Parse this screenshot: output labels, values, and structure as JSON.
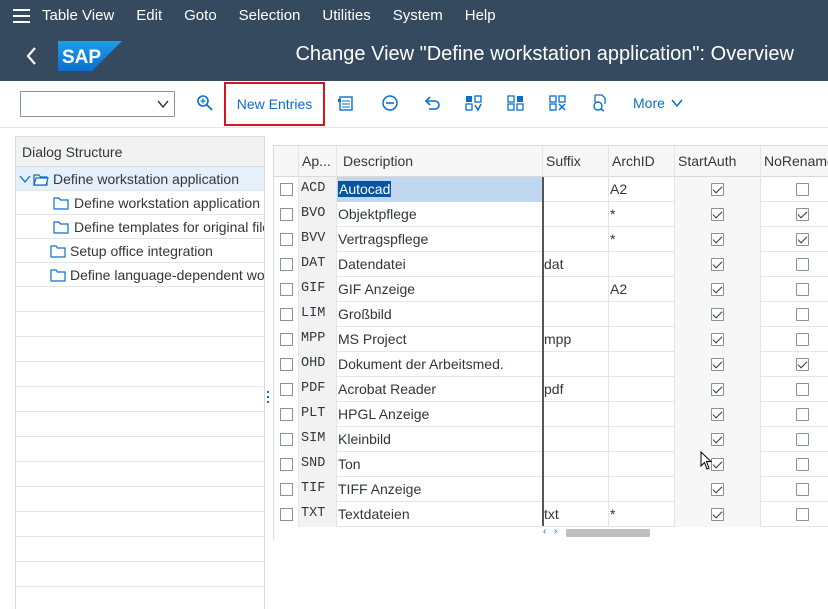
{
  "menu": [
    "Table View",
    "Edit",
    "Goto",
    "Selection",
    "Utilities",
    "System",
    "Help"
  ],
  "title": "Change View \"Define workstation application\": Overview",
  "logo_text": "SAP",
  "toolbar": {
    "new_entries": "New Entries",
    "more": "More"
  },
  "tree": {
    "header": "Dialog Structure",
    "items": [
      {
        "label": "Define workstation application",
        "level": 0
      },
      {
        "label": "Define workstation application in",
        "level": 1
      },
      {
        "label": "Define templates for original files",
        "level": 1
      },
      {
        "label": "Setup office integration",
        "level": 0
      },
      {
        "label": "Define language-dependent wor",
        "level": 0
      }
    ]
  },
  "table": {
    "columns": [
      "Ap...",
      "Description",
      "Suffix",
      "ArchID",
      "StartAuth",
      "NoRename"
    ],
    "rows": [
      {
        "app": "ACD",
        "desc": "Autocad",
        "suffix": "",
        "arch": "A2",
        "start": true,
        "norename": false
      },
      {
        "app": "BVO",
        "desc": "Objektpflege",
        "suffix": "",
        "arch": "*",
        "start": true,
        "norename": true
      },
      {
        "app": "BVV",
        "desc": "Vertragspflege",
        "suffix": "",
        "arch": "*",
        "start": true,
        "norename": true
      },
      {
        "app": "DAT",
        "desc": "Datendatei",
        "suffix": "dat",
        "arch": "",
        "start": true,
        "norename": false
      },
      {
        "app": "GIF",
        "desc": "GIF Anzeige",
        "suffix": "",
        "arch": "A2",
        "start": true,
        "norename": false
      },
      {
        "app": "LIM",
        "desc": "Großbild",
        "suffix": "",
        "arch": "",
        "start": true,
        "norename": false
      },
      {
        "app": "MPP",
        "desc": "MS Project",
        "suffix": "mpp",
        "arch": "",
        "start": true,
        "norename": false
      },
      {
        "app": "OHD",
        "desc": "Dokument der Arbeitsmed.",
        "suffix": "",
        "arch": "",
        "start": true,
        "norename": true
      },
      {
        "app": "PDF",
        "desc": "Acrobat Reader",
        "suffix": "pdf",
        "arch": "",
        "start": true,
        "norename": false
      },
      {
        "app": "PLT",
        "desc": "HPGL Anzeige",
        "suffix": "",
        "arch": "",
        "start": true,
        "norename": false
      },
      {
        "app": "SIM",
        "desc": "Kleinbild",
        "suffix": "",
        "arch": "",
        "start": true,
        "norename": false
      },
      {
        "app": "SND",
        "desc": "Ton",
        "suffix": "",
        "arch": "",
        "start": true,
        "norename": false
      },
      {
        "app": "TIF",
        "desc": "TIFF Anzeige",
        "suffix": "",
        "arch": "",
        "start": true,
        "norename": false
      },
      {
        "app": "TXT",
        "desc": "Textdateien",
        "suffix": "txt",
        "arch": "*",
        "start": true,
        "norename": false
      }
    ]
  },
  "icons": {
    "search": "magnifier-icon",
    "details": "details-icon",
    "delete": "minus-circle-icon",
    "undo": "undo-icon",
    "select_all": "select-all-icon",
    "select_block": "select-block-icon",
    "deselect_all": "deselect-all-icon",
    "print": "print-preview-icon"
  },
  "colors": {
    "shell": "#354a5f",
    "accent": "#0a6ed1",
    "highlight": "#d9141c"
  }
}
